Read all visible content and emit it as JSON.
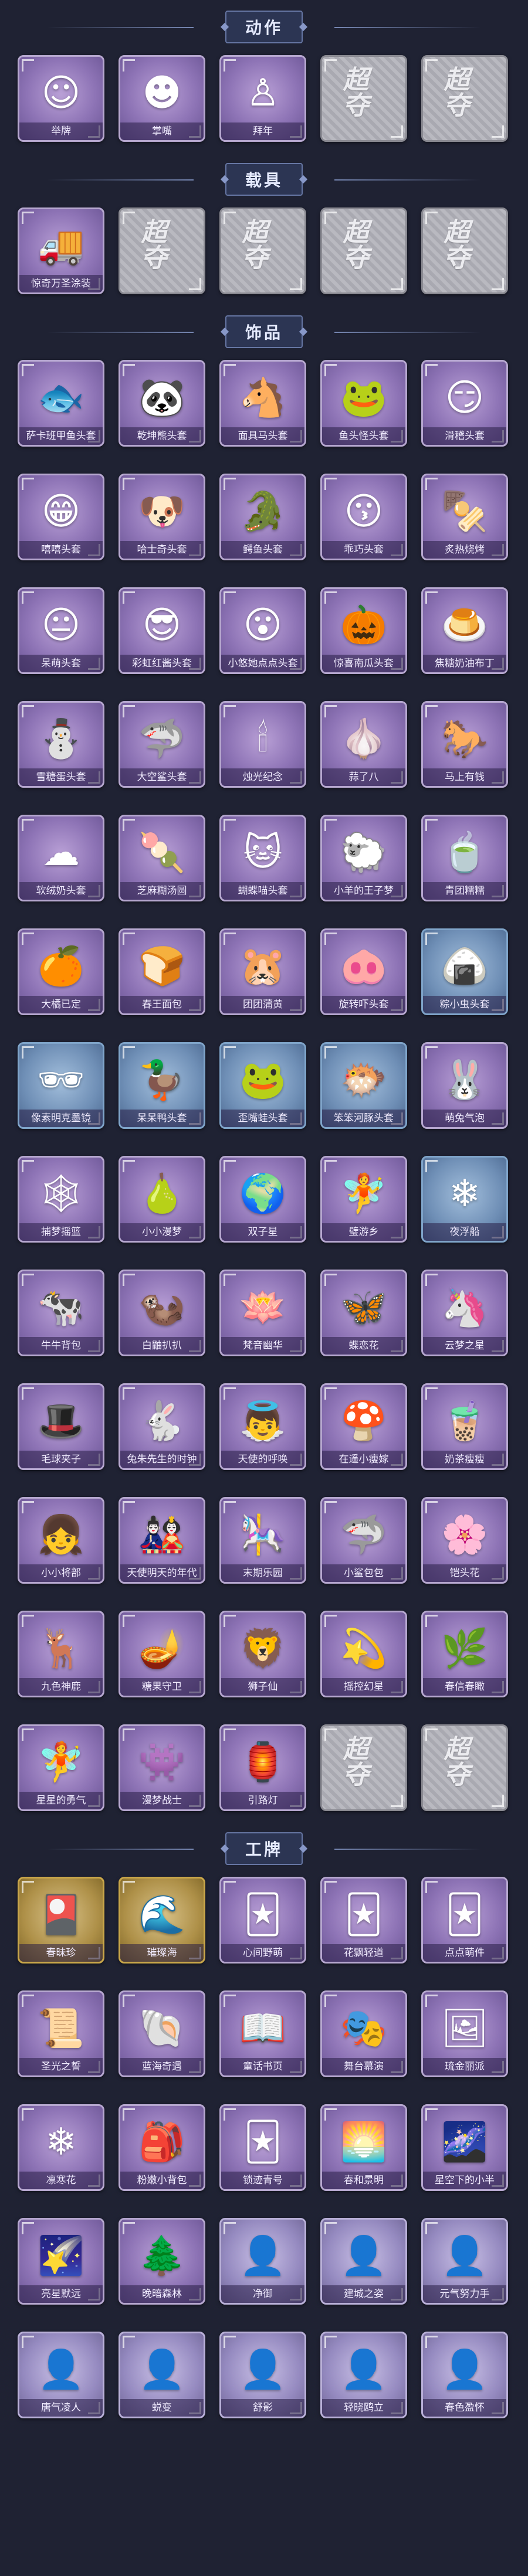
{
  "sections": [
    {
      "title": "动作",
      "items": [
        {
          "label": "举牌",
          "icon": "☺",
          "icon_name": "sign-holding-figure-icon",
          "style": "purple"
        },
        {
          "label": "掌嘴",
          "icon": "☻",
          "icon_name": "slap-figure-icon",
          "style": "purple"
        },
        {
          "label": "拜年",
          "icon": "♙",
          "icon_name": "bowing-figure-icon",
          "style": "purple"
        },
        {
          "label": "",
          "icon": "超夺",
          "icon_name": "locked-placeholder-icon",
          "style": "empty"
        },
        {
          "label": "",
          "icon": "超夺",
          "icon_name": "locked-placeholder-icon",
          "style": "empty"
        }
      ]
    },
    {
      "title": "载具",
      "items": [
        {
          "label": "惊奇万圣涂装",
          "icon": "🚚",
          "icon_name": "halloween-vehicle-icon",
          "style": "purple"
        },
        {
          "label": "",
          "icon": "超夺",
          "icon_name": "locked-placeholder-icon",
          "style": "empty"
        },
        {
          "label": "",
          "icon": "超夺",
          "icon_name": "locked-placeholder-icon",
          "style": "empty"
        },
        {
          "label": "",
          "icon": "超夺",
          "icon_name": "locked-placeholder-icon",
          "style": "empty"
        },
        {
          "label": "",
          "icon": "超夺",
          "icon_name": "locked-placeholder-icon",
          "style": "empty"
        }
      ]
    },
    {
      "title": "饰品",
      "items": [
        {
          "label": "萨卡班甲鱼头套",
          "icon": "🐟",
          "icon_name": "fish-head-icon",
          "style": "purple"
        },
        {
          "label": "乾坤熊头套",
          "icon": "🐼",
          "icon_name": "panda-head-icon",
          "style": "purple"
        },
        {
          "label": "面具马头套",
          "icon": "🐴",
          "icon_name": "horse-head-icon",
          "style": "purple"
        },
        {
          "label": "鱼头怪头套",
          "icon": "🐸",
          "icon_name": "fish-monster-head-icon",
          "style": "purple"
        },
        {
          "label": "滑稽头套",
          "icon": "😏",
          "icon_name": "smirk-face-icon",
          "style": "purple"
        },
        {
          "label": "嘻嘻头套",
          "icon": "😁",
          "icon_name": "grin-face-icon",
          "style": "purple"
        },
        {
          "label": "哈士奇头套",
          "icon": "🐶",
          "icon_name": "husky-head-icon",
          "style": "purple"
        },
        {
          "label": "鳄鱼头套",
          "icon": "🐊",
          "icon_name": "crocodile-head-icon",
          "style": "purple"
        },
        {
          "label": "乖巧头套",
          "icon": "😗",
          "icon_name": "cute-face-icon",
          "style": "purple"
        },
        {
          "label": "炙热烧烤",
          "icon": "🍢",
          "icon_name": "grill-head-icon",
          "style": "purple"
        },
        {
          "label": "呆萌头套",
          "icon": "😐",
          "icon_name": "blank-face-icon",
          "style": "purple"
        },
        {
          "label": "彩虹红酱头套",
          "icon": "😎",
          "icon_name": "sunglasses-head-icon",
          "style": "purple"
        },
        {
          "label": "小悠她点点头套",
          "icon": "😮",
          "icon_name": "fish-face-icon",
          "style": "purple"
        },
        {
          "label": "惊喜南瓜头套",
          "icon": "🎃",
          "icon_name": "pumpkin-head-icon",
          "style": "purple"
        },
        {
          "label": "焦糖奶油布丁",
          "icon": "🍮",
          "icon_name": "pudding-head-icon",
          "style": "purple"
        },
        {
          "label": "雪糖蛋头套",
          "icon": "⛄",
          "icon_name": "snowman-head-icon",
          "style": "purple"
        },
        {
          "label": "大空鲨头套",
          "icon": "🦈",
          "icon_name": "shark-head-icon",
          "style": "purple"
        },
        {
          "label": "烛光纪念",
          "icon": "🕯",
          "icon_name": "candle-head-icon",
          "style": "purple"
        },
        {
          "label": "蒜了八",
          "icon": "🧄",
          "icon_name": "garlic-head-icon",
          "style": "purple"
        },
        {
          "label": "马上有钱",
          "icon": "🐎",
          "icon_name": "lucky-horse-head-icon",
          "style": "purple"
        },
        {
          "label": "软绒奶头套",
          "icon": "☁",
          "icon_name": "cloud-head-icon",
          "style": "purple"
        },
        {
          "label": "芝麻糊汤圆",
          "icon": "🍡",
          "icon_name": "dumpling-head-icon",
          "style": "purple"
        },
        {
          "label": "蝴蝶喵头套",
          "icon": "🐱",
          "icon_name": "cat-head-icon",
          "style": "purple"
        },
        {
          "label": "小羊的王子梦",
          "icon": "🐑",
          "icon_name": "sheep-head-icon",
          "style": "purple"
        },
        {
          "label": "青团糯糯",
          "icon": "🍵",
          "icon_name": "green-bun-head-icon",
          "style": "purple"
        },
        {
          "label": "大橘已定",
          "icon": "🍊",
          "icon_name": "orange-head-icon",
          "style": "purple"
        },
        {
          "label": "春王面包",
          "icon": "🍞",
          "icon_name": "bread-head-icon",
          "style": "purple"
        },
        {
          "label": "团团蒲黄",
          "icon": "🐹",
          "icon_name": "hamster-head-icon",
          "style": "purple"
        },
        {
          "label": "旋转吓头套",
          "icon": "🐽",
          "icon_name": "pig-head-icon",
          "style": "purple"
        },
        {
          "label": "粽小虫头套",
          "icon": "🍙",
          "icon_name": "zongzi-head-icon",
          "style": "blue"
        },
        {
          "label": "像素明克墨镜",
          "icon": "🕶",
          "icon_name": "pixel-sunglasses-icon",
          "style": "blue"
        },
        {
          "label": "呆呆鸭头套",
          "icon": "🦆",
          "icon_name": "duck-head-icon",
          "style": "blue"
        },
        {
          "label": "歪嘴蛙头套",
          "icon": "🐸",
          "icon_name": "frog-head-icon",
          "style": "blue"
        },
        {
          "label": "笨笨河豚头套",
          "icon": "🐡",
          "icon_name": "pufferfish-head-icon",
          "style": "blue"
        },
        {
          "label": "萌兔气泡",
          "icon": "🐰",
          "icon_name": "bunny-bubble-icon",
          "style": "purple"
        },
        {
          "label": "捕梦摇篮",
          "icon": "🕸",
          "icon_name": "dreamcatcher-icon",
          "style": "purple"
        },
        {
          "label": "小小漫梦",
          "icon": "🍐",
          "icon_name": "pear-doll-icon",
          "style": "purple"
        },
        {
          "label": "双子星",
          "icon": "🌍",
          "icon_name": "twin-star-globe-icon",
          "style": "purple"
        },
        {
          "label": "璧游乡",
          "icon": "🧚",
          "icon_name": "fairy-doll-icon",
          "style": "purple"
        },
        {
          "label": "夜浮船",
          "icon": "❄",
          "icon_name": "night-ship-icon",
          "style": "blue"
        },
        {
          "label": "牛牛背包",
          "icon": "🐄",
          "icon_name": "cow-backpack-icon",
          "style": "purple"
        },
        {
          "label": "白鼬扒扒",
          "icon": "🦦",
          "icon_name": "weasel-icon",
          "style": "purple"
        },
        {
          "label": "梵音幽华",
          "icon": "🪷",
          "icon_name": "lotus-spirit-icon",
          "style": "purple"
        },
        {
          "label": "蝶恋花",
          "icon": "🦋",
          "icon_name": "butterfly-flower-icon",
          "style": "purple"
        },
        {
          "label": "云梦之星",
          "icon": "🦄",
          "icon_name": "cloud-star-icon",
          "style": "purple"
        },
        {
          "label": "毛球夹子",
          "icon": "🎩",
          "icon_name": "fur-clip-doll-icon",
          "style": "purple"
        },
        {
          "label": "兔朱先生的时钟",
          "icon": "🐇",
          "icon_name": "rabbit-clock-icon",
          "style": "purple"
        },
        {
          "label": "天使的呼唤",
          "icon": "👼",
          "icon_name": "angel-icon",
          "style": "purple"
        },
        {
          "label": "在遥小瘦嫁",
          "icon": "🍄",
          "icon_name": "mushroom-bride-icon",
          "style": "purple"
        },
        {
          "label": "奶茶瘦瘦",
          "icon": "🧋",
          "icon_name": "milk-tea-icon",
          "style": "purple"
        },
        {
          "label": "小小将部",
          "icon": "👧",
          "icon_name": "little-general-icon",
          "style": "purple"
        },
        {
          "label": "天使明天的年代",
          "icon": "🎎",
          "icon_name": "angel-era-icon",
          "style": "purple"
        },
        {
          "label": "末期乐园",
          "icon": "🎠",
          "icon_name": "paradise-icon",
          "style": "purple"
        },
        {
          "label": "小鲨包包",
          "icon": "🦈",
          "icon_name": "shark-bag-icon",
          "style": "purple"
        },
        {
          "label": "铠头花",
          "icon": "🌸",
          "icon_name": "armor-flower-icon",
          "style": "purple"
        },
        {
          "label": "九色神鹿",
          "icon": "🦌",
          "icon_name": "nine-color-deer-icon",
          "style": "purple"
        },
        {
          "label": "糖果守卫",
          "icon": "🪔",
          "icon_name": "candy-guard-icon",
          "style": "purple"
        },
        {
          "label": "狮子仙",
          "icon": "🦁",
          "icon_name": "lion-fairy-icon",
          "style": "purple"
        },
        {
          "label": "摇控幻星",
          "icon": "💫",
          "icon_name": "remote-star-icon",
          "style": "purple"
        },
        {
          "label": "春信春瞰",
          "icon": "🌿",
          "icon_name": "spring-sprout-icon",
          "style": "purple"
        },
        {
          "label": "星星的勇气",
          "icon": "🧚",
          "icon_name": "star-courage-icon",
          "style": "purple"
        },
        {
          "label": "漫梦战士",
          "icon": "👾",
          "icon_name": "dream-warrior-icon",
          "style": "purple"
        },
        {
          "label": "引路灯",
          "icon": "🏮",
          "icon_name": "lantern-icon",
          "style": "purple"
        },
        {
          "label": "",
          "icon": "超夺",
          "icon_name": "locked-placeholder-icon",
          "style": "empty"
        },
        {
          "label": "",
          "icon": "超夺",
          "icon_name": "locked-placeholder-icon",
          "style": "empty"
        }
      ]
    },
    {
      "title": "工牌",
      "items": [
        {
          "label": "春昧珍",
          "icon": "🎴",
          "icon_name": "red-card-icon",
          "style": "gold"
        },
        {
          "label": "璀璨海",
          "icon": "🌊",
          "icon_name": "ocean-card-icon",
          "style": "gold"
        },
        {
          "label": "心间野萌",
          "icon": "🃏",
          "icon_name": "mushroom-card-icon",
          "style": "purple"
        },
        {
          "label": "花飘轻道",
          "icon": "🃏",
          "icon_name": "flower-card-icon",
          "style": "purple"
        },
        {
          "label": "点点萌件",
          "icon": "🃏",
          "icon_name": "dots-card-icon",
          "style": "purple"
        },
        {
          "label": "圣光之誓",
          "icon": "📜",
          "icon_name": "holy-scroll-card-icon",
          "style": "purple"
        },
        {
          "label": "蓝海奇遇",
          "icon": "🐚",
          "icon_name": "blue-sea-card-icon",
          "style": "purple"
        },
        {
          "label": "童话书页",
          "icon": "📖",
          "icon_name": "fairy-book-card-icon",
          "style": "purple"
        },
        {
          "label": "舞台幕演",
          "icon": "🎭",
          "icon_name": "stage-card-icon",
          "style": "purple"
        },
        {
          "label": "琉金丽派",
          "icon": "🖼",
          "icon_name": "gold-frame-card-icon",
          "style": "purple"
        },
        {
          "label": "凛寒花",
          "icon": "❄",
          "icon_name": "frost-flower-card-icon",
          "style": "purple"
        },
        {
          "label": "粉嫩小背包",
          "icon": "🎒",
          "icon_name": "pink-backpack-card-icon",
          "style": "purple"
        },
        {
          "label": "锁迹青号",
          "icon": "🃏",
          "icon_name": "cyan-card-icon",
          "style": "purple"
        },
        {
          "label": "春和景明",
          "icon": "🌅",
          "icon_name": "spring-scene-card-icon",
          "style": "purple"
        },
        {
          "label": "星空下的小半",
          "icon": "🌌",
          "icon_name": "star-sky-card-icon",
          "style": "purple"
        },
        {
          "label": "亮星默远",
          "icon": "🌠",
          "icon_name": "bright-star-card-icon",
          "style": "purple"
        },
        {
          "label": "晚暗森林",
          "icon": "🌲",
          "icon_name": "dark-forest-card-icon",
          "style": "purple"
        },
        {
          "label": "净御",
          "icon": "👤",
          "icon_name": "silhouette-card-icon",
          "style": "lavender"
        },
        {
          "label": "建城之姿",
          "icon": "👤",
          "icon_name": "silhouette-card-icon",
          "style": "lavender"
        },
        {
          "label": "元气努力手",
          "icon": "👤",
          "icon_name": "silhouette-card-icon",
          "style": "lavender"
        },
        {
          "label": "唐气凌人",
          "icon": "👤",
          "icon_name": "silhouette-card-icon",
          "style": "lavender"
        },
        {
          "label": "蜕变",
          "icon": "👤",
          "icon_name": "silhouette-card-icon",
          "style": "lavender"
        },
        {
          "label": "舒影",
          "icon": "👤",
          "icon_name": "silhouette-card-icon",
          "style": "lavender"
        },
        {
          "label": "轻晓鸥立",
          "icon": "👤",
          "icon_name": "silhouette-card-icon",
          "style": "lavender"
        },
        {
          "label": "春色盈怀",
          "icon": "👤",
          "icon_name": "silhouette-card-icon",
          "style": "lavender"
        }
      ]
    }
  ]
}
